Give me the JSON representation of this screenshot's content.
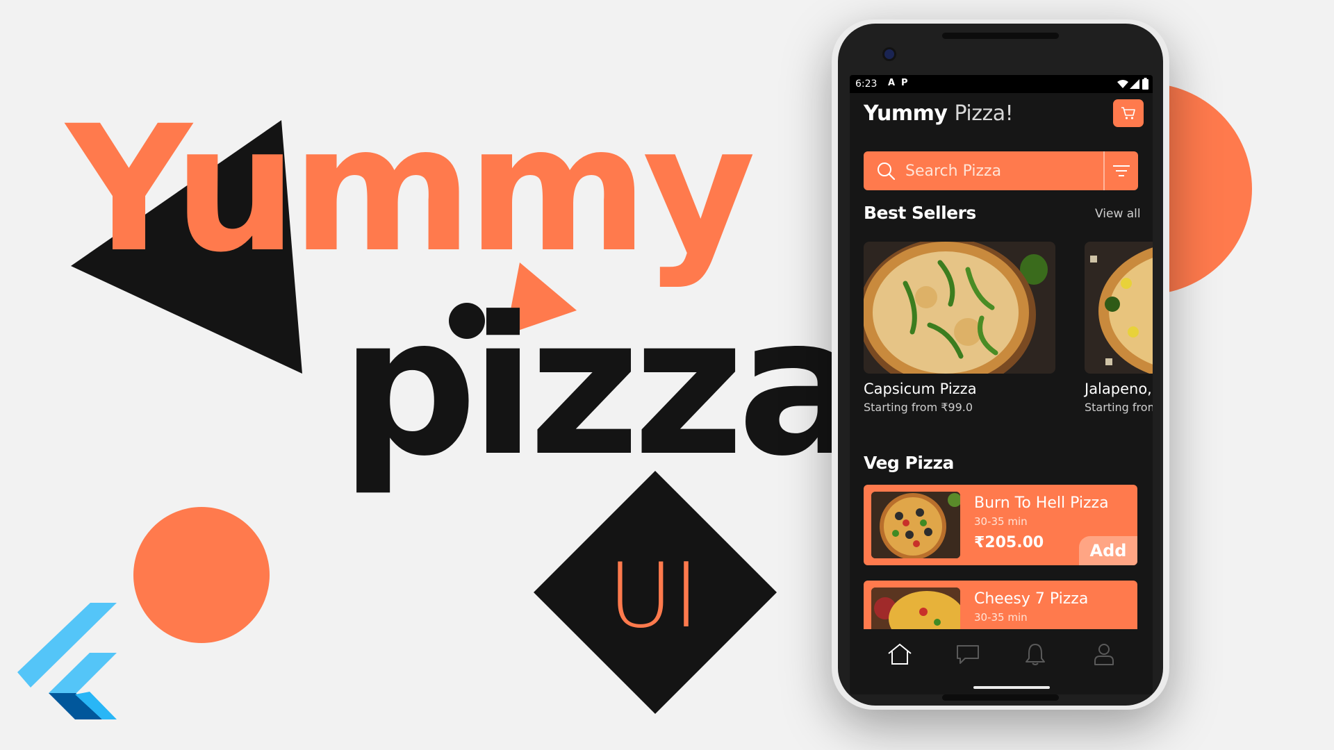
{
  "poster": {
    "word_top": "Yummy",
    "word_bottom": "pizza",
    "ui_mark": "UI",
    "accent_color": "#ff7a4d",
    "dark_color": "#141414",
    "logo_icon": "flutter-logo-icon"
  },
  "status_bar": {
    "time": "6:23",
    "left_icons": [
      "A",
      "P"
    ],
    "right_icons": [
      "wifi-icon",
      "signal-icon",
      "battery-icon"
    ]
  },
  "app": {
    "title_part1": "Yummy",
    "title_part2": "Pizza!",
    "cart_icon": "cart-icon"
  },
  "search": {
    "placeholder": "Search Pizza",
    "filter_icon": "filter-icon"
  },
  "best_sellers": {
    "title": "Best Sellers",
    "view_all": "View all",
    "items": [
      {
        "name": "Capsicum Pizza",
        "price": "Starting from ₹99.0"
      },
      {
        "name": "Jalapeno,S",
        "price": "Starting from"
      }
    ]
  },
  "veg_pizza": {
    "title": "Veg Pizza",
    "items": [
      {
        "name": "Burn To Hell Pizza",
        "time": "30-35 min",
        "price": "₹205.00",
        "add_label": "Add"
      },
      {
        "name": "Cheesy 7 Pizza",
        "time": "30-35 min"
      }
    ]
  },
  "bottom_nav": [
    "home-icon",
    "chat-icon",
    "bell-icon",
    "profile-icon"
  ]
}
